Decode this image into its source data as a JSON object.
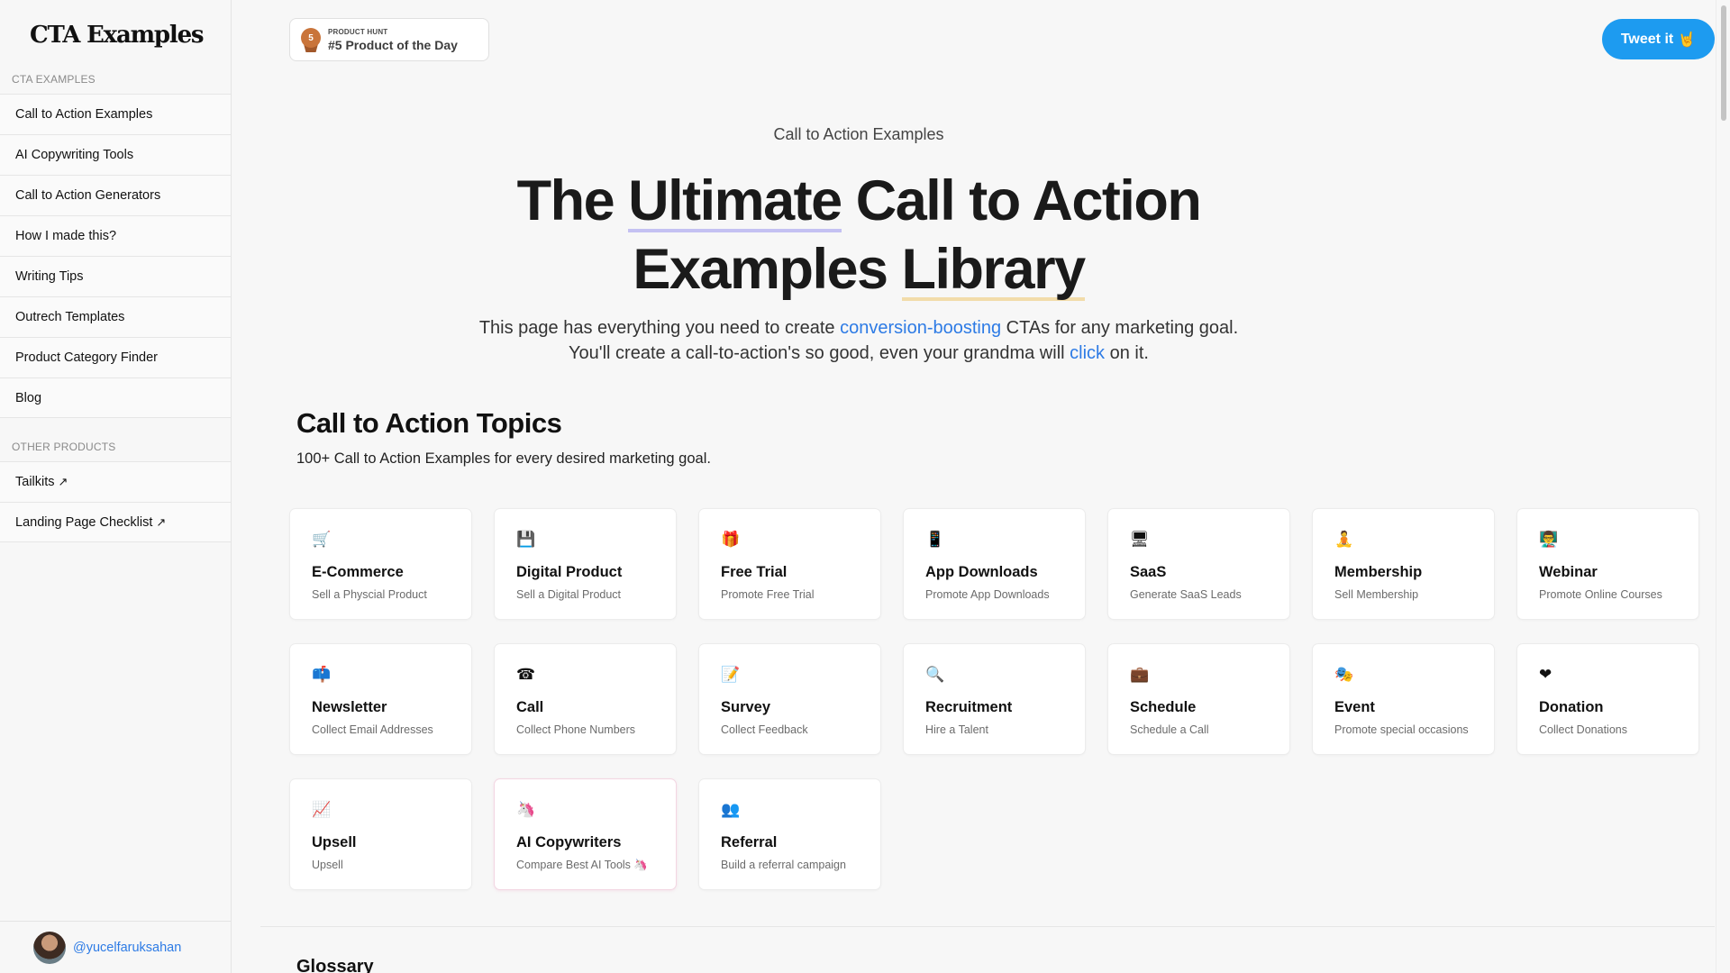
{
  "sidebar": {
    "logo": "CTA Examples",
    "section1_label": "CTA EXAMPLES",
    "items": [
      {
        "label": "Call to Action Examples"
      },
      {
        "label": "AI Copywriting Tools"
      },
      {
        "label": "Call to Action Generators"
      },
      {
        "label": "How I made this?"
      },
      {
        "label": "Writing Tips"
      },
      {
        "label": "Outrech Templates"
      },
      {
        "label": "Product Category Finder"
      },
      {
        "label": "Blog"
      }
    ],
    "section2_label": "OTHER PRODUCTS",
    "other_items": [
      {
        "label": "Tailkits",
        "ext": "↗"
      },
      {
        "label": "Landing Page Checklist",
        "ext": "↗"
      }
    ],
    "user_handle": "@yucelfaruksahan"
  },
  "header": {
    "badge_rank": "5",
    "badge_small": "PRODUCT HUNT",
    "badge_big": "#5 Product of the Day",
    "tweet_label": "Tweet it",
    "tweet_emoji": "🤘"
  },
  "hero": {
    "eyebrow": "Call to Action Examples",
    "title_1": "The ",
    "title_hl1": "Ultimate",
    "title_2": " Call to Action",
    "title_3": "Examples ",
    "title_hl2": "Library",
    "sub_1": "This page has everything you need to create ",
    "sub_link1": "conversion-boosting",
    "sub_2": " CTAs for any marketing goal.",
    "sub_3": "You'll create a call-to-action's so good, even your grandma will ",
    "sub_link2": "click",
    "sub_4": " on it."
  },
  "topics": {
    "title": "Call to Action Topics",
    "subtitle": "100+ Call to Action Examples for every desired marketing goal.",
    "cards": [
      {
        "icon": "🛒",
        "title": "E-Commerce",
        "sub": "Sell a Physcial Product"
      },
      {
        "icon": "💾",
        "title": "Digital Product",
        "sub": "Sell a Digital Product"
      },
      {
        "icon": "🎁",
        "title": "Free Trial",
        "sub": "Promote Free Trial"
      },
      {
        "icon": "📱",
        "title": "App Downloads",
        "sub": "Promote App Downloads"
      },
      {
        "icon": "🖥",
        "title": "SaaS",
        "sub": "Generate SaaS Leads"
      },
      {
        "icon": "🧘",
        "title": "Membership",
        "sub": "Sell Membership"
      },
      {
        "icon": "👨‍🏫",
        "title": "Webinar",
        "sub": "Promote Online Courses"
      },
      {
        "icon": "📫",
        "title": "Newsletter",
        "sub": "Collect Email Addresses"
      },
      {
        "icon": "☎",
        "title": "Call",
        "sub": "Collect Phone Numbers"
      },
      {
        "icon": "📝",
        "title": "Survey",
        "sub": "Collect Feedback"
      },
      {
        "icon": "🔍",
        "title": "Recruitment",
        "sub": "Hire a Talent"
      },
      {
        "icon": "💼",
        "title": "Schedule",
        "sub": "Schedule a Call"
      },
      {
        "icon": "🎭",
        "title": "Event",
        "sub": "Promote special occasions"
      },
      {
        "icon": "❤",
        "title": "Donation",
        "sub": "Collect Donations"
      },
      {
        "icon": "📈",
        "title": "Upsell",
        "sub": "Upsell"
      },
      {
        "icon": "🦄",
        "title": "AI Copywriters",
        "sub": "Compare Best AI Tools 🦄"
      },
      {
        "icon": "👥",
        "title": "Referral",
        "sub": "Build a referral campaign"
      }
    ]
  },
  "glossary": {
    "title": "Glossary"
  },
  "colors": {
    "accent_blue": "#2d7be5",
    "tweet_blue": "#1d9bf0",
    "highlight_purple": "#c4c1f2",
    "highlight_yellow": "#f2dcaa"
  }
}
